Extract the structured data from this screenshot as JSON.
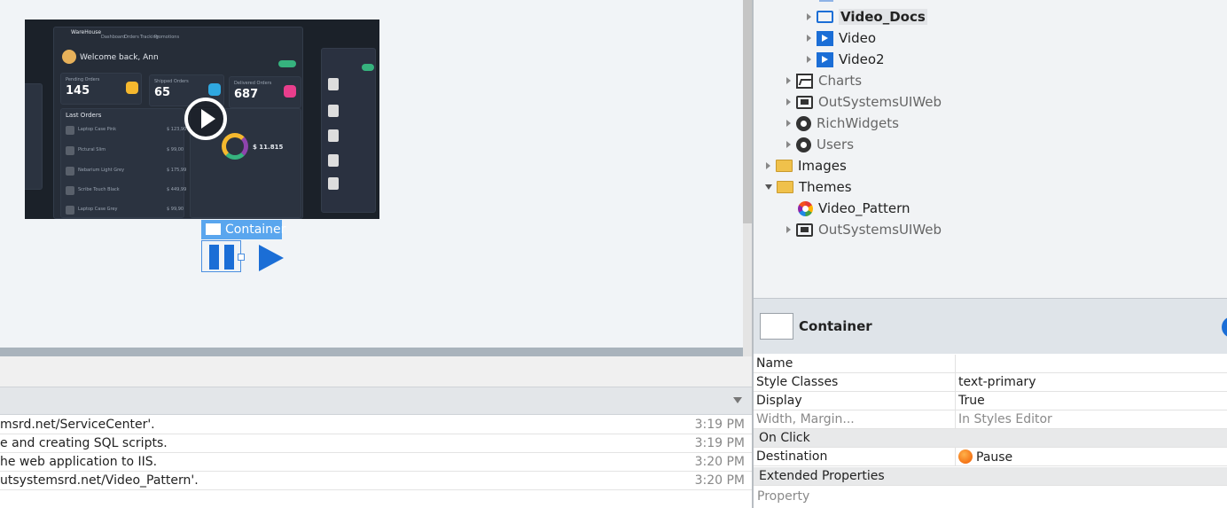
{
  "canvas": {
    "video_preview": {
      "brand": "WareHouse",
      "nav": [
        "Dashboard",
        "Orders",
        "Tracking",
        "Promotions"
      ],
      "welcome": "Welcome back, Ann",
      "stats": [
        {
          "label": "Pending Orders",
          "value": "145"
        },
        {
          "label": "Shipped Orders",
          "value": "65"
        },
        {
          "label": "Delivered Orders",
          "value": "687"
        }
      ],
      "last_orders_title": "Last Orders",
      "orders": [
        {
          "name": "Laptop Case Pink",
          "price": "$ 123,90"
        },
        {
          "name": "Pictural Slim",
          "price": "$ 99,00"
        },
        {
          "name": "Nebarium Light Grey",
          "price": "$ 175,99"
        },
        {
          "name": "Scribe Touch Black",
          "price": "$ 449,99"
        },
        {
          "name": "Laptop Case Grey",
          "price": "$ 99,90"
        }
      ],
      "total": "$ 11.815"
    },
    "container_label": "Container"
  },
  "output": {
    "rows": [
      {
        "message": "msrd.net/ServiceCenter'.",
        "time": "3:19 PM"
      },
      {
        "message": "e and creating SQL scripts.",
        "time": "3:19 PM"
      },
      {
        "message": "he web application to IIS.",
        "time": "3:20 PM"
      },
      {
        "message": "utsystemsrd.net/Video_Pattern'.",
        "time": "3:20 PM"
      }
    ]
  },
  "tree": {
    "items": [
      {
        "label": "Video_Docs",
        "icon": "screen-icon",
        "selected": true
      },
      {
        "label": "Video",
        "icon": "video-icon"
      },
      {
        "label": "Video2",
        "icon": "video-icon"
      },
      {
        "label": "Charts",
        "icon": "chart-icon"
      },
      {
        "label": "OutSystemsUIWeb",
        "icon": "monitor-icon"
      },
      {
        "label": "RichWidgets",
        "icon": "ring-icon"
      },
      {
        "label": "Users",
        "icon": "ring-icon"
      },
      {
        "label": "Images",
        "icon": "folder-icon"
      },
      {
        "label": "Themes",
        "icon": "folder-icon"
      },
      {
        "label": "Video_Pattern",
        "icon": "theme-icon"
      },
      {
        "label": "OutSystemsUIWeb",
        "icon": "monitor-icon"
      }
    ]
  },
  "properties": {
    "title": "Container",
    "rows": [
      {
        "key": "Name",
        "value": ""
      },
      {
        "key": "Style Classes",
        "value": "text-primary"
      },
      {
        "key": "Display",
        "value": "True"
      },
      {
        "key": "Width, Margin...",
        "value": "In Styles Editor"
      }
    ],
    "section_on_click": "On Click",
    "destination_key": "Destination",
    "destination_value": "Pause",
    "section_extended": "Extended Properties",
    "property_placeholder": "Property"
  },
  "colors": {
    "accent": "#1b6ed6",
    "selection_label": "#5aa6ee",
    "canvas_bg": "#f1f4f7"
  }
}
